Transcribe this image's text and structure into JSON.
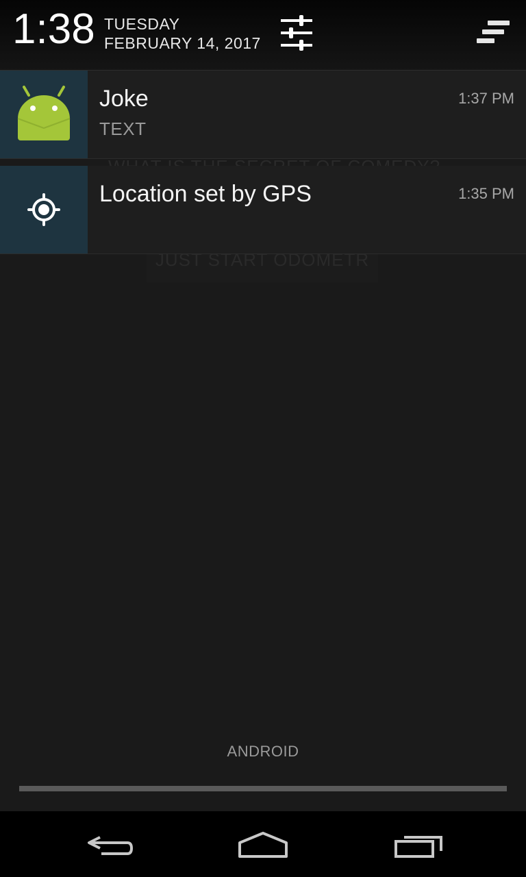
{
  "status": {
    "time": "1:38",
    "day": "TUESDAY",
    "date": "FEBRUARY 14, 2017"
  },
  "notifications": [
    {
      "title": "Joke",
      "subtitle": "TEXT",
      "time": "1:37 PM",
      "icon": "android-robot-icon"
    },
    {
      "title": "Location set by GPS",
      "subtitle": "",
      "time": "1:35 PM",
      "icon": "gps-location-icon"
    }
  ],
  "background_app": {
    "question": "WHAT IS THE SECRET OF COMEDY?",
    "button": "JUST START ODOMETR"
  },
  "carrier": "ANDROID",
  "colors": {
    "accent_icon_bg": "#1e3440",
    "android_green": "#a4c639"
  },
  "nav": {
    "back_icon": "back-icon",
    "home_icon": "home-icon",
    "recents_icon": "recents-icon"
  }
}
